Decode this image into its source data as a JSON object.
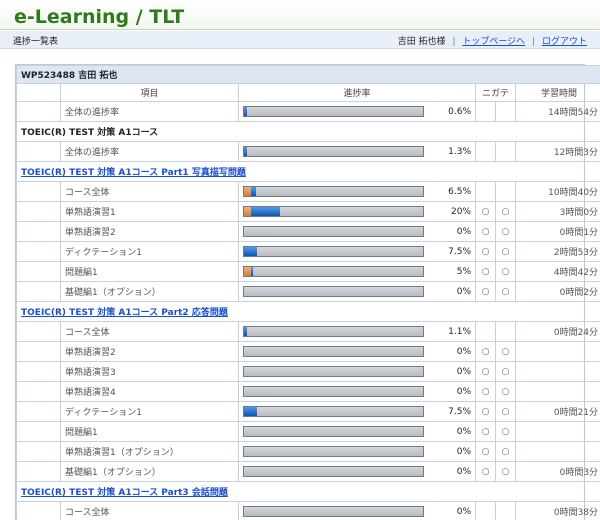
{
  "header": {
    "logo": "e-Learning / TLT"
  },
  "subbar": {
    "title": "進捗一覧表",
    "user": "吉田 拓也様",
    "top_link": "トップページへ",
    "logout": "ログアウト",
    "sep": "|"
  },
  "student": {
    "id_name": "WP523488 吉田 拓也"
  },
  "columns": {
    "item": "項目",
    "progress": "進捗率",
    "nigate": "ニガテ",
    "time": "学習時間"
  },
  "colors": {
    "blue": "#0e56b4",
    "orange": "#e5782b",
    "logo": "#2f7a1a"
  },
  "rows": [
    {
      "type": "item",
      "label": "全体の進捗率",
      "pct": 0.6,
      "pct_text": "0.6%",
      "mark1": "",
      "mark2": "",
      "time": "14時間54分",
      "orange": false
    },
    {
      "type": "section",
      "label": "TOEIC(R) TEST 対策 A1コース"
    },
    {
      "type": "item",
      "label": "全体の進捗率",
      "pct": 1.3,
      "pct_text": "1.3%",
      "mark1": "",
      "mark2": "",
      "time": "12時間3分",
      "orange": false
    },
    {
      "type": "part",
      "label": "TOEIC(R) TEST 対策 A1コース Part1 写真描写問題"
    },
    {
      "type": "item",
      "label": "コース全体",
      "pct": 6.5,
      "pct_text": "6.5%",
      "mark1": "",
      "mark2": "",
      "time": "10時間40分",
      "orange": true
    },
    {
      "type": "item",
      "label": "単熟語演習1",
      "pct": 20,
      "pct_text": "20%",
      "mark1": "○",
      "mark2": "○",
      "time": "3時間0分",
      "orange": true
    },
    {
      "type": "item",
      "label": "単熟語演習2",
      "pct": 0,
      "pct_text": "0%",
      "mark1": "○",
      "mark2": "○",
      "time": "0時間1分",
      "orange": false
    },
    {
      "type": "item",
      "label": "ディクテーション1",
      "pct": 7.5,
      "pct_text": "7.5%",
      "mark1": "○",
      "mark2": "○",
      "time": "2時間53分",
      "orange": false
    },
    {
      "type": "item",
      "label": "問題編1",
      "pct": 5,
      "pct_text": "5%",
      "mark1": "○",
      "mark2": "○",
      "time": "4時間42分",
      "orange": true
    },
    {
      "type": "item",
      "label": "基礎編1（オプション）",
      "pct": 0,
      "pct_text": "0%",
      "mark1": "○",
      "mark2": "○",
      "time": "0時間2分",
      "orange": false
    },
    {
      "type": "part",
      "label": "TOEIC(R) TEST 対策 A1コース Part2 応答問題"
    },
    {
      "type": "item",
      "label": "コース全体",
      "pct": 1.1,
      "pct_text": "1.1%",
      "mark1": "",
      "mark2": "",
      "time": "0時間24分",
      "orange": false
    },
    {
      "type": "item",
      "label": "単熟語演習2",
      "pct": 0,
      "pct_text": "0%",
      "mark1": "○",
      "mark2": "○",
      "time": "",
      "orange": false
    },
    {
      "type": "item",
      "label": "単熟語演習3",
      "pct": 0,
      "pct_text": "0%",
      "mark1": "○",
      "mark2": "○",
      "time": "",
      "orange": false
    },
    {
      "type": "item",
      "label": "単熟語演習4",
      "pct": 0,
      "pct_text": "0%",
      "mark1": "○",
      "mark2": "○",
      "time": "",
      "orange": false
    },
    {
      "type": "item",
      "label": "ディクテーション1",
      "pct": 7.5,
      "pct_text": "7.5%",
      "mark1": "○",
      "mark2": "○",
      "time": "0時間21分",
      "orange": false
    },
    {
      "type": "item",
      "label": "問題編1",
      "pct": 0,
      "pct_text": "0%",
      "mark1": "○",
      "mark2": "○",
      "time": "",
      "orange": false
    },
    {
      "type": "item",
      "label": "単熟語演習1（オプション）",
      "pct": 0,
      "pct_text": "0%",
      "mark1": "○",
      "mark2": "○",
      "time": "",
      "orange": false
    },
    {
      "type": "item",
      "label": "基礎編1（オプション）",
      "pct": 0,
      "pct_text": "0%",
      "mark1": "○",
      "mark2": "○",
      "time": "0時間3分",
      "orange": false
    },
    {
      "type": "part",
      "label": "TOEIC(R) TEST 対策 A1コース Part3 会話問題"
    },
    {
      "type": "item",
      "label": "コース全体",
      "pct": 0,
      "pct_text": "0%",
      "mark1": "",
      "mark2": "",
      "time": "0時間38分",
      "orange": false
    }
  ]
}
